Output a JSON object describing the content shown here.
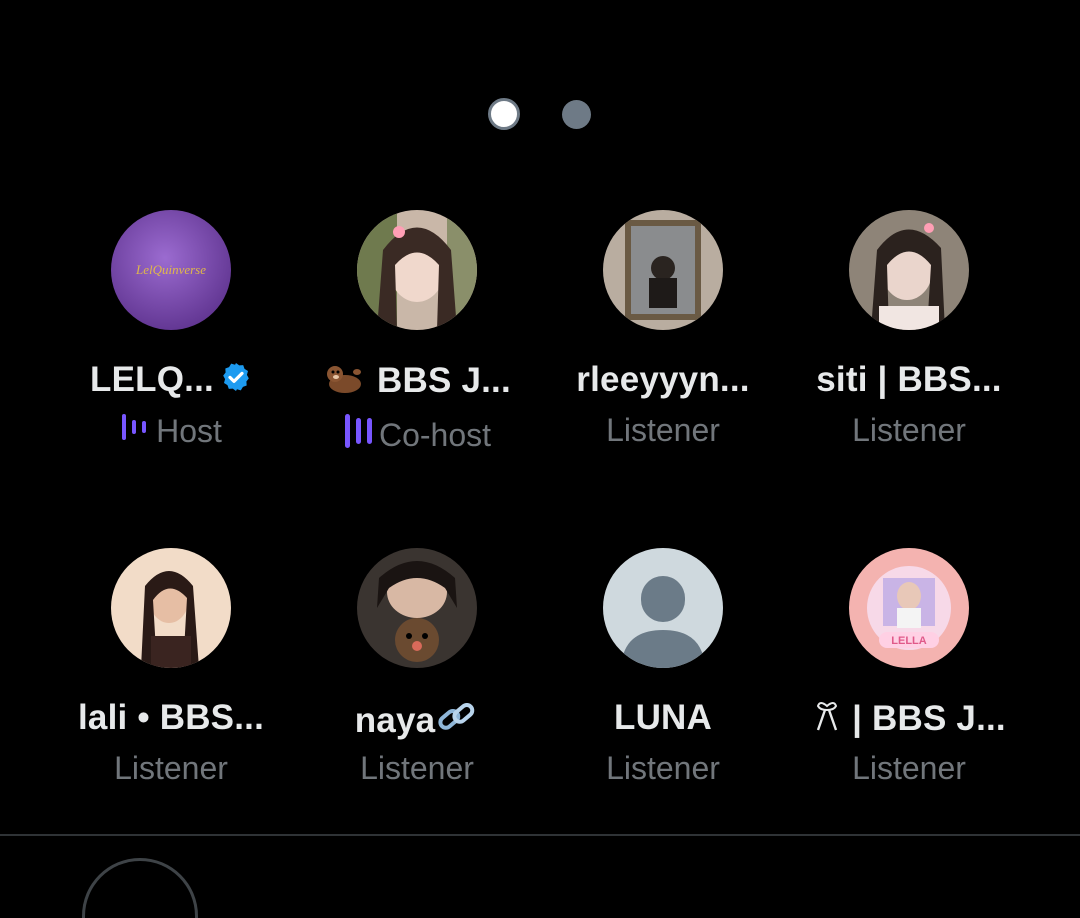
{
  "pager": {
    "pages": 2,
    "active_page": 1
  },
  "colors": {
    "background": "#000000",
    "name_text": "#e7e9ea",
    "role_text": "#71767b",
    "speaking_bars": "#7856ff",
    "verified_badge": "#1d9bf0"
  },
  "participants": [
    {
      "name": "LELQ...",
      "role": "Host",
      "verified": true,
      "speaking_icon": "speaking-bars-icon",
      "avatar": "lelquinverse-logo",
      "avatar_text": "LelQuinverse"
    },
    {
      "name": "BBS J...",
      "name_prefix_icon": "otter-emoji-icon",
      "role": "Co-host",
      "speaking_icon": "speaking-bars-icon",
      "avatar": "photo-girl-hair-clip"
    },
    {
      "name": "rleeyyyn...",
      "role": "Listener",
      "avatar": "photo-mirror-selfie"
    },
    {
      "name": "siti | BBS...",
      "role": "Listener",
      "avatar": "photo-girl-bow"
    },
    {
      "name": "lali • BBS...",
      "role": "Listener",
      "avatar": "photo-girl-portrait"
    },
    {
      "name": "naya",
      "name_suffix_icon": "link-emoji-icon",
      "role": "Listener",
      "avatar": "photo-girl-plush"
    },
    {
      "name": "LUNA",
      "role": "Listener",
      "avatar": "default-profile-icon"
    },
    {
      "name": "| BBS J...",
      "name_prefix_icon": "ribbon-emoji-icon",
      "role": "Listener",
      "avatar": "photo-pink-edit",
      "avatar_text": "LELLA"
    }
  ]
}
